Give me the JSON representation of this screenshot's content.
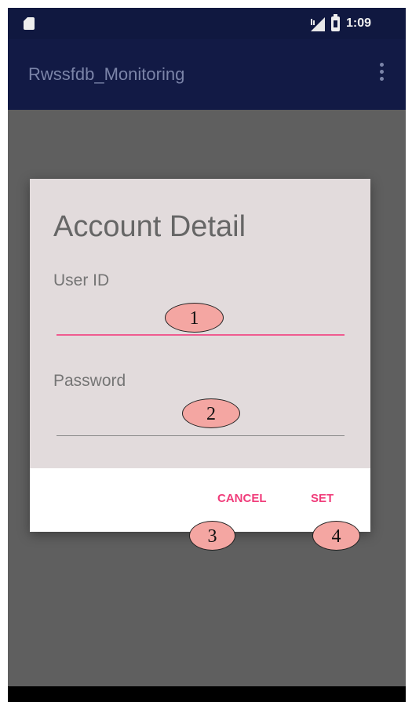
{
  "status_bar": {
    "time": "1:09",
    "sd_icon": "sd-card-icon",
    "signal_icon": "signal-icon",
    "battery_icon": "battery-icon"
  },
  "app_bar": {
    "title": "Rwssfdb_Monitoring",
    "menu_icon": "overflow-menu-icon"
  },
  "dialog": {
    "title": "Account Detail",
    "user_id": {
      "label": "User ID",
      "value": ""
    },
    "password": {
      "label": "Password",
      "value": ""
    },
    "buttons": {
      "cancel": "CANCEL",
      "set": "SET"
    }
  },
  "annotations": [
    "1",
    "2",
    "3",
    "4"
  ],
  "colors": {
    "accent": "#f03c7a",
    "app_bar": "#121a45",
    "dialog_body": "#e2dbdc",
    "scrim": "#5f5f5f",
    "callout_fill": "#f4a6a2"
  }
}
